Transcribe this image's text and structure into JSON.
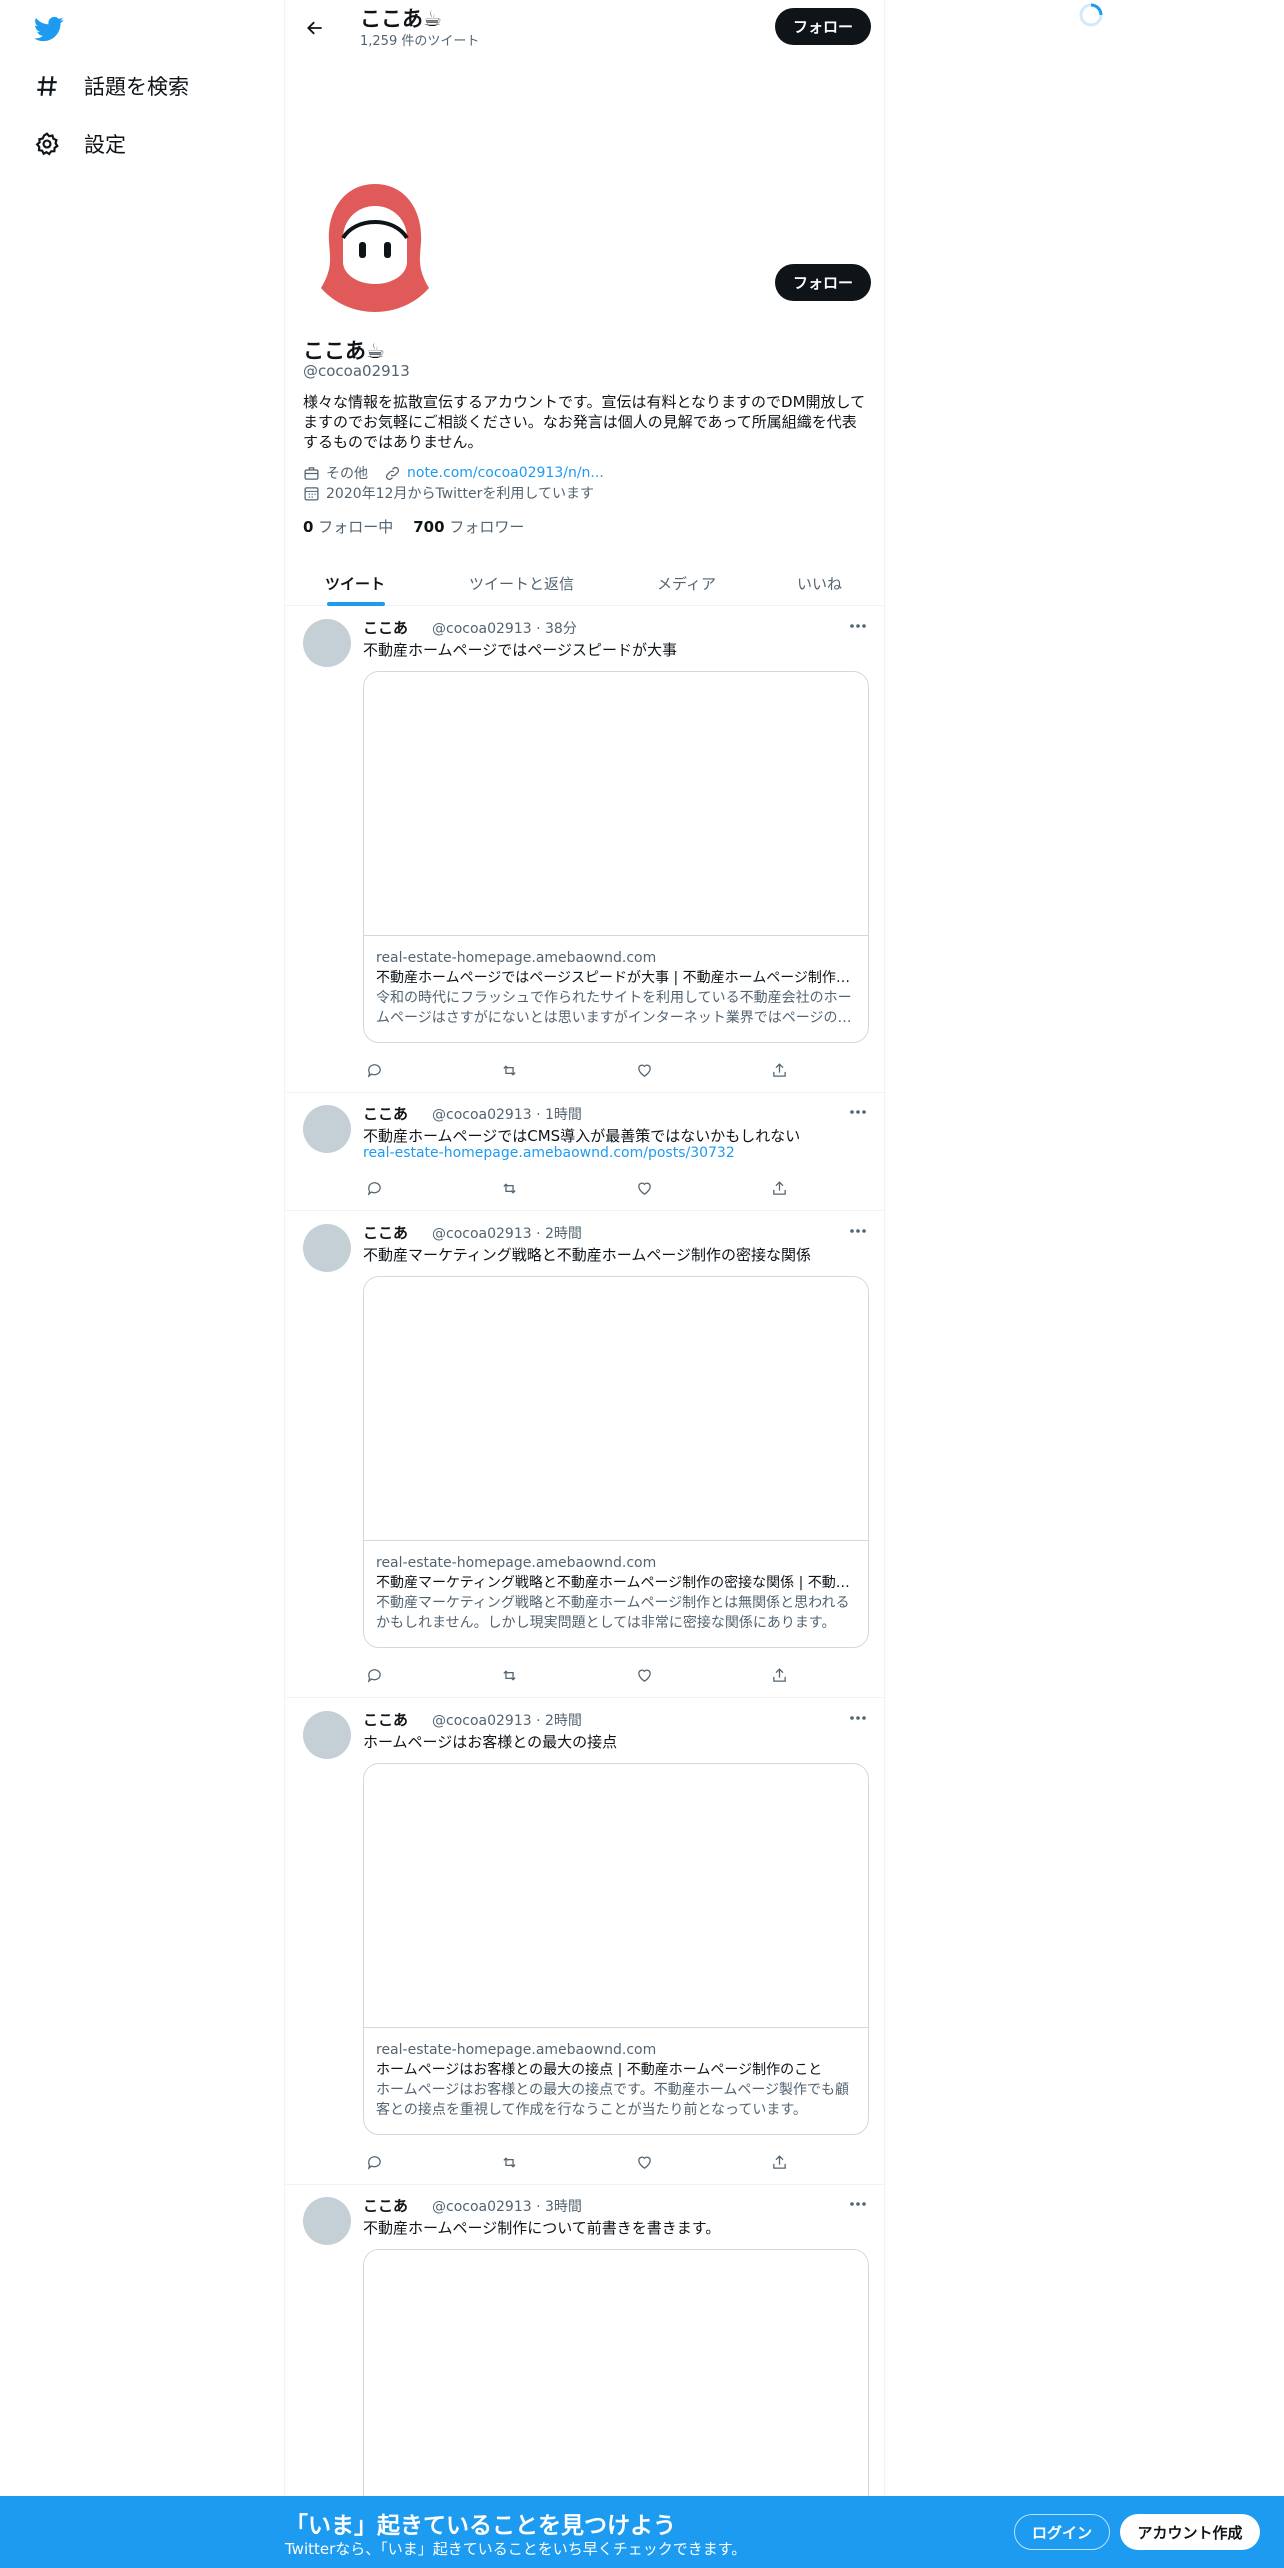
{
  "colors": {
    "accent": "#1d9bf0",
    "follow_button": "#0f1419",
    "avatar_placeholder": "#c4cfd6",
    "profile_avatar": "#e05a5a"
  },
  "nav": {
    "items": [
      {
        "label": "話題を検索",
        "icon": "hashtag-icon"
      },
      {
        "label": "設定",
        "icon": "gear-icon"
      }
    ]
  },
  "header": {
    "title": "ここあ☕",
    "tweet_count": "1,259 件のツイート",
    "follow_label": "フォロー"
  },
  "profile": {
    "follow_label": "フォロー",
    "name": "ここあ☕",
    "handle": "@cocoa02913",
    "bio": "様々な情報を拡散宣伝するアカウントです。宣伝は有料となりますのでDM開放してますのでお気軽にご相談ください。なお発言は個人の見解であって所属組織を代表するものではありません。",
    "category": "その他",
    "link": "note.com/cocoa02913/n/n...",
    "joined": "2020年12月からTwitterを利用しています",
    "following_count": "0",
    "following_label": "フォロー中",
    "followers_count": "700",
    "followers_label": "フォロワー"
  },
  "tabs": [
    "ツイート",
    "ツイートと返信",
    "メディア",
    "いいね"
  ],
  "tweets": [
    {
      "name": "ここあ",
      "meta": "@cocoa02913 · 38分",
      "text": "不動産ホームページではページスピードが大事",
      "card": {
        "domain": "real-estate-homepage.amebaownd.com",
        "title": "不動産ホームページではページスピードが大事 | 不動産ホームページ制作のこと",
        "desc": "令和の時代にフラッシュで作られたサイトを利用している不動産会社のホームページはさすがにないとは思いますがインターネット業界ではページの表示速度が"
      }
    },
    {
      "name": "ここあ",
      "meta": "@cocoa02913 · 1時間",
      "text": "不動産ホームページではCMS導入が最善策ではないかもしれない",
      "link": "real-estate-homepage.amebaownd.com/posts/30732"
    },
    {
      "name": "ここあ",
      "meta": "@cocoa02913 · 2時間",
      "text": "不動産マーケティング戦略と不動産ホームページ制作の密接な関係",
      "card": {
        "domain": "real-estate-homepage.amebaownd.com",
        "title": "不動産マーケティング戦略と不動産ホームページ制作の密接な関係 | 不動産ホームページ制作のこと",
        "desc": "不動産マーケティング戦略と不動産ホームページ制作とは無関係と思われるかもしれません。しかし現実問題としては非常に密接な関係にあります。"
      }
    },
    {
      "name": "ここあ",
      "meta": "@cocoa02913 · 2時間",
      "text": "ホームページはお客様との最大の接点",
      "card": {
        "domain": "real-estate-homepage.amebaownd.com",
        "title": "ホームページはお客様との最大の接点 | 不動産ホームページ制作のこと",
        "desc": "ホームページはお客様との最大の接点です。不動産ホームページ製作でも顧客との接点を重視して作成を行なうことが当たり前となっています。"
      }
    },
    {
      "name": "ここあ",
      "meta": "@cocoa02913 · 3時間",
      "text": "不動産ホームページ制作について前書きを書きます。"
    }
  ],
  "bottom_bar": {
    "title": "「いま」起きていることを見つけよう",
    "subtitle": "Twitterなら、「いま」起きていることをいち早くチェックできます。",
    "login_label": "ログイン",
    "signup_label": "アカウント作成"
  }
}
